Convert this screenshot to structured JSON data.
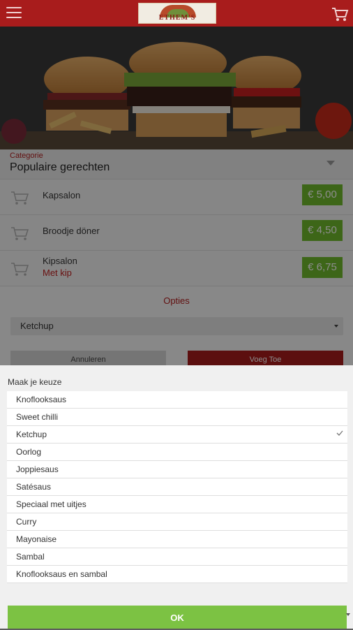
{
  "header": {
    "logo_text": "ETHEM'S",
    "colors": {
      "bar": "#a81c1c"
    }
  },
  "category": {
    "label": "Categorie",
    "value": "Populaire gerechten"
  },
  "products": [
    {
      "name": "Kapsalon",
      "subtitle": "",
      "price": "€ 5,00"
    },
    {
      "name": "Broodje döner",
      "subtitle": "",
      "price": "€ 4,50"
    },
    {
      "name": "Kipsalon",
      "subtitle": "Met kip",
      "price": "€ 6,75"
    }
  ],
  "options": {
    "heading": "Opties",
    "selected_value": "Ketchup",
    "cancel_label": "Annuleren",
    "add_label": "Voeg Toe"
  },
  "picker": {
    "title": "Maak je keuze",
    "items": [
      {
        "label": "Knoflooksaus"
      },
      {
        "label": "Sweet chilli"
      },
      {
        "label": "Ketchup",
        "selected": true
      },
      {
        "label": "Oorlog"
      },
      {
        "label": "Joppiesaus"
      },
      {
        "label": "Satésaus"
      },
      {
        "label": "Speciaal met uitjes"
      },
      {
        "label": "Curry"
      },
      {
        "label": "Mayonaise"
      },
      {
        "label": "Sambal"
      },
      {
        "label": "Knoflooksaus en sambal"
      }
    ],
    "ok_label": "OK"
  },
  "icons": {
    "menu": "hamburger-menu-icon",
    "cart": "shopping-cart-icon",
    "check": "checkmark-icon"
  },
  "colors": {
    "price": "#6fbb2c",
    "ok": "#7cc243",
    "accent": "#b32020"
  }
}
